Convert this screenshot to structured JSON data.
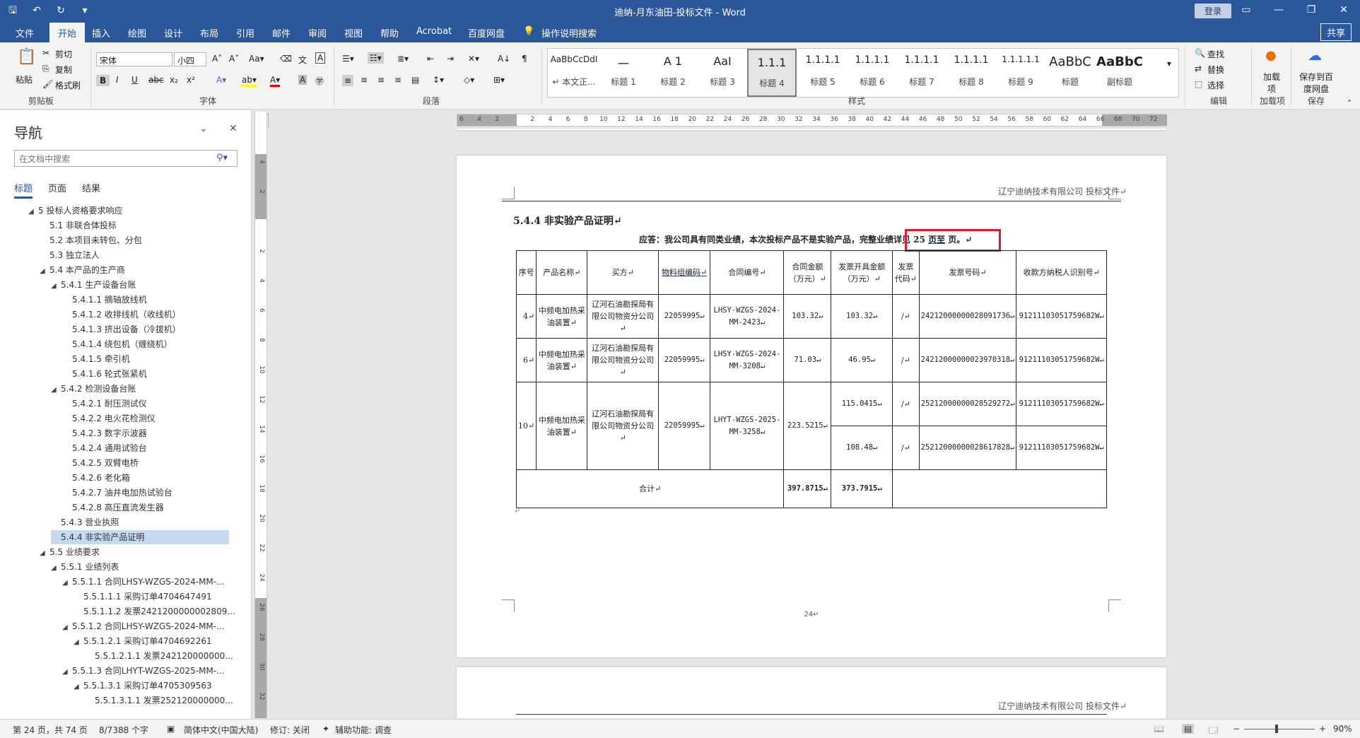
{
  "window": {
    "title": "迪纳-月东油田-投标文件 - Word",
    "login_label": "登录",
    "share_label": "共享"
  },
  "tabs": [
    "文件",
    "开始",
    "插入",
    "绘图",
    "设计",
    "布局",
    "引用",
    "邮件",
    "审阅",
    "视图",
    "帮助",
    "Acrobat",
    "百度网盘",
    "操作说明搜索"
  ],
  "ribbon": {
    "clipboard": {
      "paste": "粘贴",
      "cut": "剪切",
      "copy": "复制",
      "format_painter": "格式刷",
      "label": "剪贴板"
    },
    "font": {
      "name": "宋体",
      "size": "小四",
      "label": "字体"
    },
    "paragraph_label": "段落",
    "styles_label": "样式",
    "styles": [
      {
        "sample": "AaBbCcDdI",
        "name": "↵ 本文正..."
      },
      {
        "sample": "一",
        "name": "标题 1"
      },
      {
        "sample": "A 1",
        "name": "标题 2"
      },
      {
        "sample": "AaI",
        "name": "标题 3"
      },
      {
        "sample": "1.1.1",
        "name": "标题 4"
      },
      {
        "sample": "1.1.1.1",
        "name": "标题 5"
      },
      {
        "sample": "1.1.1.1",
        "name": "标题 6"
      },
      {
        "sample": "1.1.1.1",
        "name": "标题 7"
      },
      {
        "sample": "1.1.1.1",
        "name": "标题 8"
      },
      {
        "sample": "1.1.1.1.1",
        "name": "标题 9"
      },
      {
        "sample": "AaBbC",
        "name": "标题"
      },
      {
        "sample": "AaBbC",
        "name": "副标题"
      }
    ],
    "editing": {
      "find": "查找",
      "replace": "替换",
      "select": "选择",
      "label": "编辑"
    },
    "addins": {
      "btn": "加载项",
      "label": "加载项"
    },
    "save": {
      "btn": "保存到百度网盘",
      "label": "保存"
    }
  },
  "nav": {
    "title": "导航",
    "search_placeholder": "在文档中搜索",
    "subtabs": [
      "标题",
      "页面",
      "结果"
    ],
    "tree": [
      {
        "level": 0,
        "caret": "◢",
        "text": "5 投标人资格要求响应"
      },
      {
        "level": 1,
        "caret": "",
        "text": "5.1 非联合体投标"
      },
      {
        "level": 1,
        "caret": "",
        "text": "5.2 本项目未转包、分包"
      },
      {
        "level": 1,
        "caret": "",
        "text": "5.3 独立法人"
      },
      {
        "level": 1,
        "caret": "◢",
        "text": "5.4 本产品的生产商"
      },
      {
        "level": 2,
        "caret": "◢",
        "text": "5.4.1 生产设备台账"
      },
      {
        "level": 3,
        "caret": "",
        "text": "5.4.1.1 摘轴放线机"
      },
      {
        "level": 3,
        "caret": "",
        "text": "5.4.1.2 收排线机（收线机）"
      },
      {
        "level": 3,
        "caret": "",
        "text": "5.4.1.3 挤出设备（冷拔机）"
      },
      {
        "level": 3,
        "caret": "",
        "text": "5.4.1.4 绕包机（缠绕机）"
      },
      {
        "level": 3,
        "caret": "",
        "text": "5.4.1.5 牵引机"
      },
      {
        "level": 3,
        "caret": "",
        "text": "5.4.1.6 轮式张紧机"
      },
      {
        "level": 2,
        "caret": "◢",
        "text": "5.4.2 检测设备台账"
      },
      {
        "level": 3,
        "caret": "",
        "text": "5.4.2.1 耐压测试仪"
      },
      {
        "level": 3,
        "caret": "",
        "text": "5.4.2.2 电火花检测仪"
      },
      {
        "level": 3,
        "caret": "",
        "text": "5.4.2.3 数字示波器"
      },
      {
        "level": 3,
        "caret": "",
        "text": "5.4.2.4 通用试验台"
      },
      {
        "level": 3,
        "caret": "",
        "text": "5.4.2.5 双臂电桥"
      },
      {
        "level": 3,
        "caret": "",
        "text": "5.4.2.6 老化箱"
      },
      {
        "level": 3,
        "caret": "",
        "text": "5.4.2.7 油井电加热试验台"
      },
      {
        "level": 3,
        "caret": "",
        "text": "5.4.2.8 高压直流发生器"
      },
      {
        "level": 2,
        "caret": "",
        "text": "5.4.3 营业执照"
      },
      {
        "level": 2,
        "caret": "",
        "text": "5.4.4 非实验产品证明",
        "selected": true
      },
      {
        "level": 1,
        "caret": "◢",
        "text": "5.5 业绩要求"
      },
      {
        "level": 2,
        "caret": "◢",
        "text": "5.5.1 业绩列表"
      },
      {
        "level": 3,
        "caret": "◢",
        "text": "5.5.1.1 合同LHSY-WZGS-2024-MM-..."
      },
      {
        "level": 4,
        "caret": "",
        "text": "5.5.1.1.1 采购订单4704647491"
      },
      {
        "level": 4,
        "caret": "",
        "text": "5.5.1.1.2 发票2421200000002809..."
      },
      {
        "level": 3,
        "caret": "◢",
        "text": "5.5.1.2 合同LHSY-WZGS-2024-MM-..."
      },
      {
        "level": 4,
        "caret": "◢",
        "text": "5.5.1.2.1 采购订单4704692261"
      },
      {
        "level": 5,
        "caret": "",
        "text": "5.5.1.2.1.1 发票242120000000..."
      },
      {
        "level": 3,
        "caret": "◢",
        "text": "5.5.1.3 合同LHYT-WZGS-2025-MM-..."
      },
      {
        "level": 4,
        "caret": "◢",
        "text": "5.5.1.3.1 采购订单4705309563"
      },
      {
        "level": 5,
        "caret": "",
        "text": "5.5.1.3.1.1 发票252120000000..."
      }
    ]
  },
  "hruler_ticks": [
    "6",
    "4",
    "2",
    "",
    "2",
    "4",
    "6",
    "8",
    "10",
    "12",
    "14",
    "16",
    "18",
    "20",
    "22",
    "24",
    "26",
    "28",
    "30",
    "32",
    "34",
    "36",
    "38",
    "40",
    "42",
    "44",
    "46",
    "48",
    "50",
    "52",
    "54",
    "56",
    "58",
    "60",
    "62",
    "64",
    "66",
    "68",
    "70",
    "72"
  ],
  "vruler_ticks": [
    "4",
    "2",
    "",
    "2",
    "4",
    "6",
    "8",
    "10",
    "12",
    "14",
    "16",
    "18",
    "20",
    "22",
    "24",
    "26",
    "28",
    "30",
    "32"
  ],
  "document": {
    "header_text": "辽宁迪纳技术有限公司    投标文件↵",
    "heading": "5.4.4 非实验产品证明↵",
    "answer_prefix": "应答：我公司具有同类业绩，本次投标产品不是实验产品，完整业绩详见 25 ",
    "answer_highlight": "页至",
    "answer_suffix": "  页。↵",
    "table": {
      "headers": [
        "序号",
        "产品名称↵",
        "买方↵",
        "物料组编码↵",
        "合同编号↵",
        "合同金额（万元）↵",
        "发票开具金额（万元）↵",
        "发票代码↵",
        "发票号码↵",
        "收款方纳税人识别号↵"
      ],
      "rows": [
        {
          "no": "4↵",
          "product": "中频电加热采油装置↵",
          "buyer": "辽河石油勘探局有限公司物资分公司↵",
          "material": "22059995↵",
          "contract": "LHSY-WZGS-2024-MM-2423↵",
          "amount": "103.32↵",
          "invoices": [
            {
              "amount": "103.32↵",
              "code": "/↵",
              "number": "24212000000028091736↵",
              "taxid": "912111030517596​82W↵"
            }
          ]
        },
        {
          "no": "6↵",
          "product": "中频电加热采油装置↵",
          "buyer": "辽河石油勘探局有限公司物资分公司↵",
          "material": "22059995↵",
          "contract": "LHSY-WZGS-2024-MM-3208↵",
          "amount": "71.03↵",
          "invoices": [
            {
              "amount": "46.95↵",
              "code": "/↵",
              "number": "24212000000023970318↵",
              "taxid": "91211103051759682W↵"
            }
          ]
        },
        {
          "no": "10↵",
          "product": "中频电加热采油装置↵",
          "buyer": "辽河石油勘探局有限公司物资分公司↵",
          "material": "22059995↵",
          "contract": "LHYT-WZGS-2025-MM-3258↵",
          "amount": "223.5215↵",
          "invoices": [
            {
              "amount": "115.0415↵",
              "code": "/↵",
              "number": "25212000000028529272↵",
              "taxid": "91211103051759682W↵"
            },
            {
              "amount": "108.48↵",
              "code": "/↵",
              "number": "25212000000028617828↵",
              "taxid": "91211103051759682W↵"
            }
          ]
        }
      ],
      "total_label": "合计↵",
      "total_amount": "397.8715↵",
      "total_invoice": "373.7915↵"
    },
    "page_number": "24↵",
    "next_header_text": "辽宁迪纳技术有限公司    投标文件↵"
  },
  "status": {
    "page": "第 24 页，共 74 页",
    "words": "8/7388 个字",
    "language": "简体中文(中国大陆)",
    "track": "修订: 关闭",
    "accessibility": "辅助功能: 调查",
    "zoom": "90%"
  },
  "colors": {
    "accent": "#2b579a",
    "highlight_box": "#d22030",
    "nav_selected": "#c7d9f1"
  }
}
